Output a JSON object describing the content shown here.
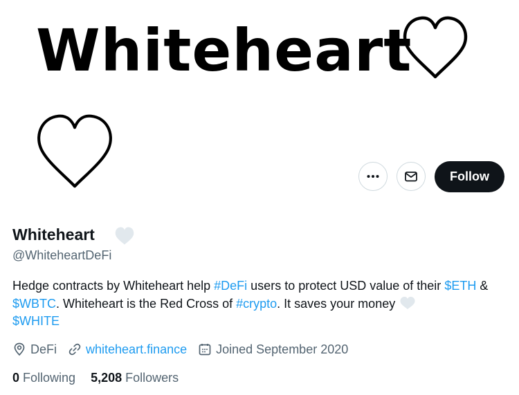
{
  "banner": {
    "title": "Whiteheart"
  },
  "profile": {
    "display_name": "Whiteheart",
    "handle": "@WhiteheartDeFi",
    "follow_label": "Follow",
    "more_icon": "more-icon",
    "mail_icon": "mail-icon"
  },
  "bio": {
    "t1": "Hedge contracts by Whiteheart help ",
    "tag_defi": "#DeFi",
    "t2": " users to protect USD value of their ",
    "cash_eth": "$ETH",
    "t3": " & ",
    "cash_wbtc": "$WBTC",
    "t4": ". Whiteheart is the Red Cross of ",
    "tag_crypto": "#crypto",
    "t5": ". It saves your money ",
    "cash_white": "$WHITE"
  },
  "meta": {
    "location": "DeFi",
    "website": "whiteheart.finance",
    "joined": "Joined September 2020"
  },
  "stats": {
    "following_count": "0",
    "following_label": "Following",
    "followers_count": "5,208",
    "followers_label": "Followers"
  },
  "colors": {
    "link": "#1d9bf0",
    "text": "#0f1419",
    "secondary": "#536471",
    "follow_bg": "#0f1419",
    "heart_emoji": "#e1e8ed"
  }
}
